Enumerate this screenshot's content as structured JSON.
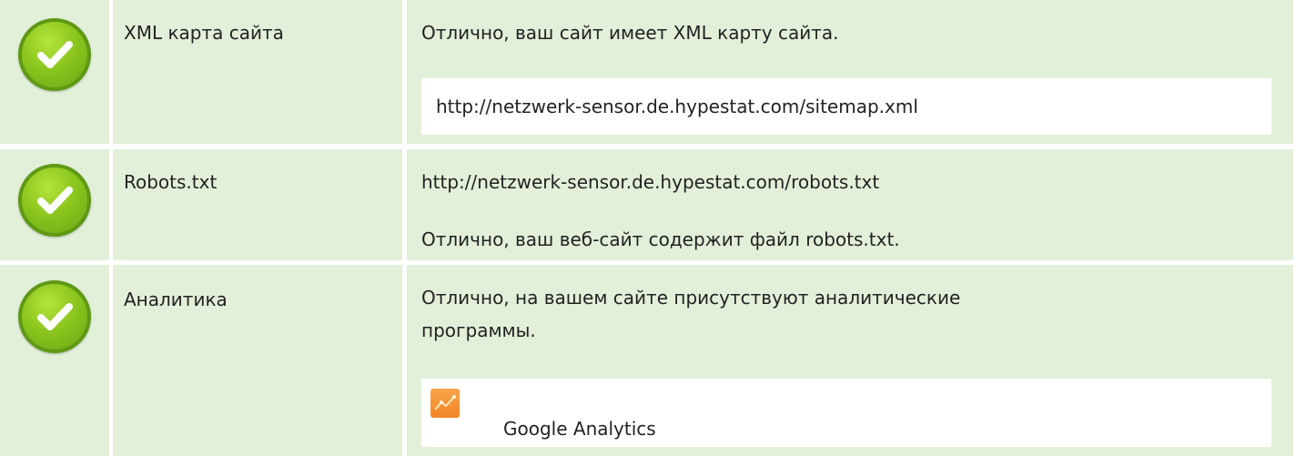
{
  "rows": [
    {
      "name": "XML карта сайта",
      "message": "Отлично, ваш сайт имеет XML карту сайта.",
      "detail": "http://netzwerk-sensor.de.hypestat.com/sitemap.xml",
      "status_icon": "check-icon"
    },
    {
      "name": "Robots.txt",
      "detail": "http://netzwerk-sensor.de.hypestat.com/robots.txt",
      "message": "Отлично, ваш веб-сайт содержит файл robots.txt.",
      "status_icon": "check-icon"
    },
    {
      "name": "Аналитика",
      "message_line1": "Отлично, на вашем сайте присутствуют аналитические",
      "message_line2": "программы.",
      "tool": "Google Analytics",
      "tool_icon": "google-analytics-icon",
      "status_icon": "check-icon"
    }
  ],
  "colors": {
    "cell_background": "#e2f0da",
    "check_green": "#8cc61e",
    "analytics_orange": "#f28526"
  }
}
